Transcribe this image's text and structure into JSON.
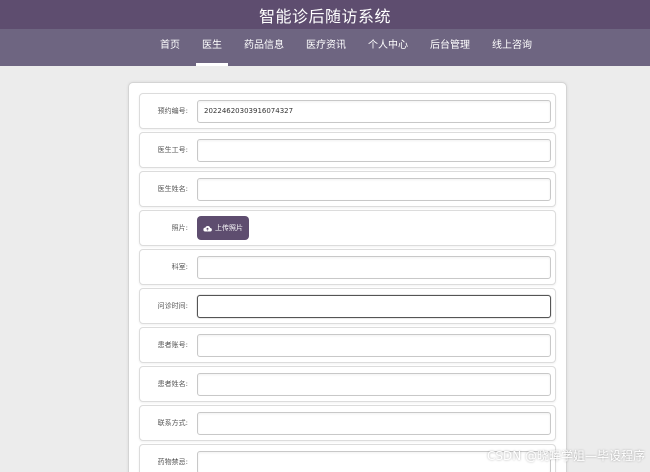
{
  "header": {
    "title": "智能诊后随访系统"
  },
  "nav": {
    "items": [
      {
        "label": "首页"
      },
      {
        "label": "医生"
      },
      {
        "label": "药品信息"
      },
      {
        "label": "医疗资讯"
      },
      {
        "label": "个人中心"
      },
      {
        "label": "后台管理"
      },
      {
        "label": "线上咨询"
      }
    ],
    "active": "医生"
  },
  "form": {
    "appointment_no": {
      "label": "预约编号:",
      "value": "20224620303916074327"
    },
    "doctor_id": {
      "label": "医生工号:",
      "value": ""
    },
    "doctor_name": {
      "label": "医生姓名:",
      "value": ""
    },
    "photo": {
      "label": "照片:",
      "button": "上传照片",
      "icon": "cloud-upload-icon"
    },
    "department": {
      "label": "科室:",
      "value": ""
    },
    "visit_time": {
      "label": "问诊时间:",
      "value": ""
    },
    "patient_account": {
      "label": "患者账号:",
      "value": ""
    },
    "patient_name": {
      "label": "患者姓名:",
      "value": ""
    },
    "contact": {
      "label": "联系方式:",
      "value": ""
    },
    "medication": {
      "label": "药物禁忌:",
      "value": ""
    }
  },
  "watermark": "CSDN @晓晖学姐—毕设程序"
}
